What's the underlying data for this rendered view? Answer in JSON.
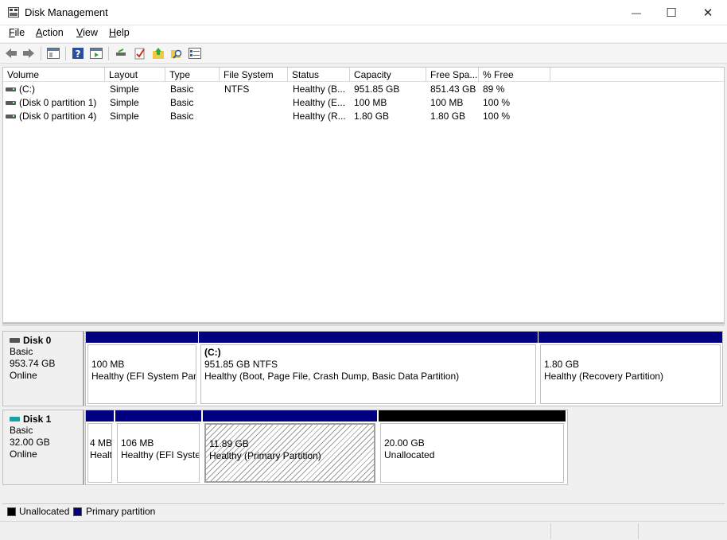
{
  "window": {
    "title": "Disk Management",
    "controls": {
      "minimize": "—",
      "maximize": "☐",
      "close": "✕"
    }
  },
  "menu": [
    {
      "key": "F",
      "rest": "ile"
    },
    {
      "key": "A",
      "rest": "ction"
    },
    {
      "key": "V",
      "rest": "iew"
    },
    {
      "key": "H",
      "rest": "elp"
    }
  ],
  "toolbar": {
    "buttons": [
      "back-icon",
      "forward-icon",
      "show-hide-console-tree-icon",
      "help-icon",
      "show-action-pane-icon",
      "connect-drive-icon",
      "checklist-icon",
      "folder-up-icon",
      "search-folder-icon",
      "properties-icon"
    ]
  },
  "volume_list": {
    "headers": [
      "Volume",
      "Layout",
      "Type",
      "File System",
      "Status",
      "Capacity",
      "Free Spa...",
      "% Free"
    ],
    "rows": [
      [
        "(C:)",
        "Simple",
        "Basic",
        "NTFS",
        "Healthy (B...",
        "951.85 GB",
        "851.43 GB",
        "89 %"
      ],
      [
        "(Disk 0 partition 1)",
        "Simple",
        "Basic",
        "",
        "Healthy (E...",
        "100 MB",
        "100 MB",
        "100 %"
      ],
      [
        "(Disk 0 partition 4)",
        "Simple",
        "Basic",
        "",
        "Healthy (R...",
        "1.80 GB",
        "1.80 GB",
        "100 %"
      ]
    ]
  },
  "disks": [
    {
      "name": "Disk 0",
      "type": "Basic",
      "size": "953.74 GB",
      "state": "Online",
      "partitions": [
        {
          "l1": "",
          "l2": "100 MB",
          "l3": "Healthy (EFI System Partition)",
          "kind": "primary"
        },
        {
          "l1": "(C:)",
          "l2": "951.85 GB NTFS",
          "l3": "Healthy (Boot, Page File, Crash Dump, Basic Data Partition)",
          "kind": "primary"
        },
        {
          "l1": "",
          "l2": "1.80 GB",
          "l3": "Healthy (Recovery Partition)",
          "kind": "primary"
        }
      ]
    },
    {
      "name": "Disk 1",
      "type": "Basic",
      "size": "32.00 GB",
      "state": "Online",
      "partitions": [
        {
          "l1": "",
          "l2": "4 MB",
          "l3": "Healthy",
          "kind": "primary"
        },
        {
          "l1": "",
          "l2": "106 MB",
          "l3": "Healthy (EFI System Partition)",
          "kind": "primary"
        },
        {
          "l1": "",
          "l2": "11.89 GB",
          "l3": "Healthy (Primary Partition)",
          "kind": "primary",
          "selected": true
        },
        {
          "l1": "",
          "l2": "20.00 GB",
          "l3": "Unallocated",
          "kind": "unallocated"
        }
      ]
    }
  ],
  "legend": [
    {
      "label": "Unallocated",
      "color": "#000000"
    },
    {
      "label": "Primary partition",
      "color": "#000080"
    }
  ]
}
